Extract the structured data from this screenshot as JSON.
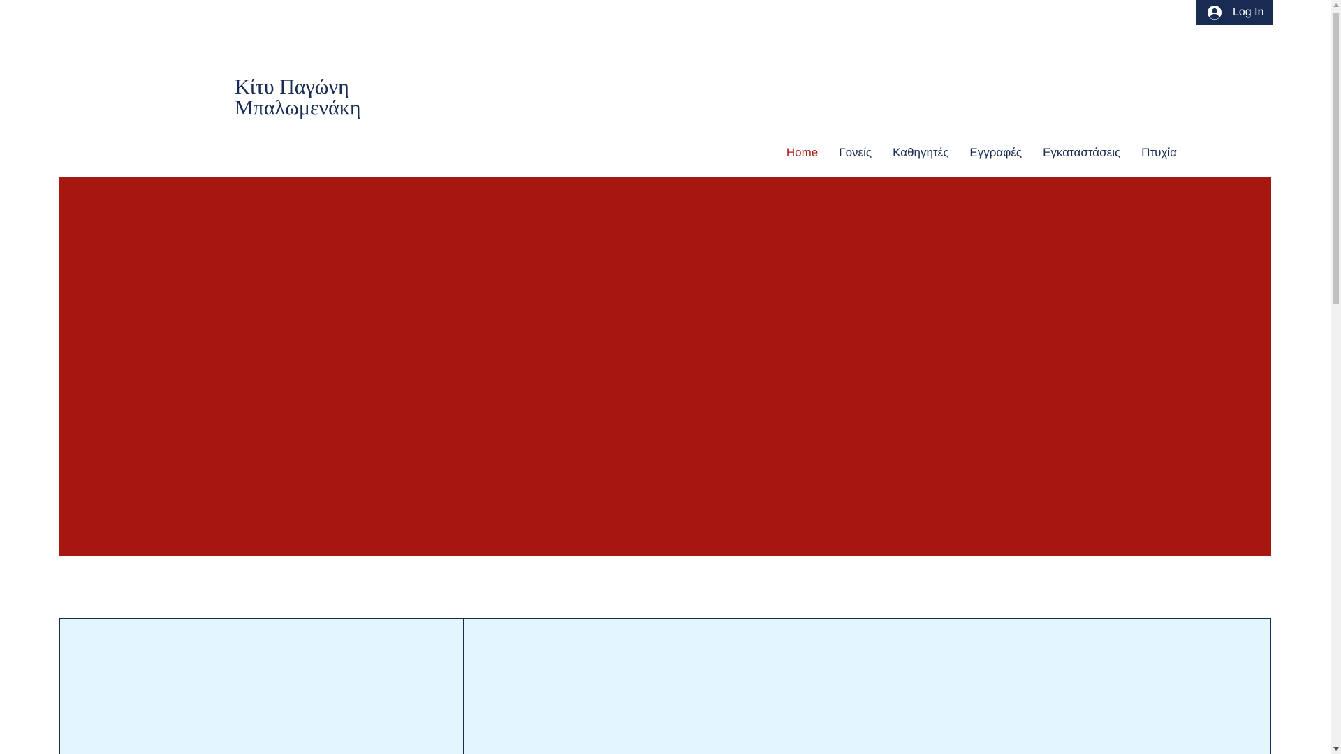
{
  "header": {
    "login_label": "Log In",
    "login_icon": "user-circle-icon",
    "site_title_line1": "Κίτυ Παγώνη",
    "site_title_line2": "Μπαλωμενάκη"
  },
  "nav": {
    "items": [
      {
        "label": "Home",
        "active": true
      },
      {
        "label": "Γονείς",
        "active": false
      },
      {
        "label": "Καθηγητές",
        "active": false
      },
      {
        "label": "Εγγραφές",
        "active": false
      },
      {
        "label": "Εγκαταστάσεις",
        "active": false
      },
      {
        "label": "Πτυχία",
        "active": false
      }
    ]
  },
  "colors": {
    "brand_navy": "#182b52",
    "accent_red": "#a51a0f",
    "hero_red": "#a6180f",
    "card_bg": "#e3f6fd"
  }
}
